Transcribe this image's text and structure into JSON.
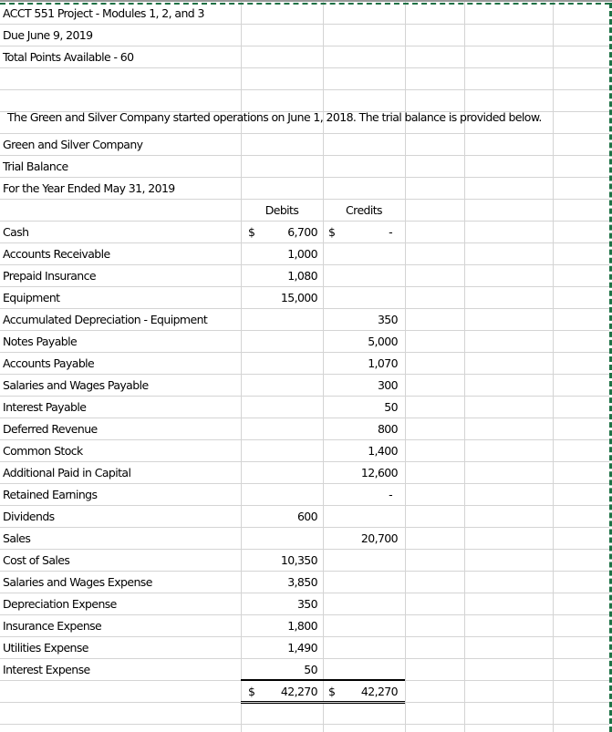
{
  "header": {
    "title": "ACCT 551 Project - Modules 1, 2, and 3",
    "due": "Due June 9, 2019",
    "points": "Total Points Available - 60"
  },
  "intro": "The Green and Silver Company started operations on June 1, 2018.  The trial balance is provided below.",
  "report": {
    "company": "Green and Silver Company",
    "statement": "Trial Balance",
    "period": "For the Year Ended May 31, 2019",
    "col_debits": "Debits",
    "col_credits": "Credits",
    "currency_symbol": "$",
    "accounts": [
      {
        "name": "Cash",
        "debit": "6,700",
        "credit": "-",
        "debit_symbol": "$",
        "credit_symbol": "$"
      },
      {
        "name": "Accounts Receivable",
        "debit": "1,000",
        "credit": ""
      },
      {
        "name": "Prepaid Insurance",
        "debit": "1,080",
        "credit": ""
      },
      {
        "name": "Equipment",
        "debit": "15,000",
        "credit": ""
      },
      {
        "name": "Accumulated Depreciation - Equipment",
        "debit": "",
        "credit": "350"
      },
      {
        "name": "Notes Payable",
        "debit": "",
        "credit": "5,000"
      },
      {
        "name": "Accounts Payable",
        "debit": "",
        "credit": "1,070"
      },
      {
        "name": "Salaries and Wages Payable",
        "debit": "",
        "credit": "300"
      },
      {
        "name": "Interest Payable",
        "debit": "",
        "credit": "50"
      },
      {
        "name": "Deferred Revenue",
        "debit": "",
        "credit": "800"
      },
      {
        "name": "Common Stock",
        "debit": "",
        "credit": "1,400"
      },
      {
        "name": "Additional Paid in Capital",
        "debit": "",
        "credit": "12,600"
      },
      {
        "name": "Retained Earnings",
        "debit": "",
        "credit": "-"
      },
      {
        "name": "Dividends",
        "debit": "600",
        "credit": ""
      },
      {
        "name": "Sales",
        "debit": "",
        "credit": "20,700"
      },
      {
        "name": "Cost of Sales",
        "debit": "10,350",
        "credit": ""
      },
      {
        "name": "Salaries and Wages Expense",
        "debit": "3,850",
        "credit": ""
      },
      {
        "name": "Depreciation Expense",
        "debit": "350",
        "credit": ""
      },
      {
        "name": "Insurance Expense",
        "debit": "1,800",
        "credit": ""
      },
      {
        "name": "Utilities Expense",
        "debit": "1,490",
        "credit": ""
      },
      {
        "name": "Interest Expense",
        "debit": "50",
        "credit": ""
      }
    ],
    "totals": {
      "debit": "42,270",
      "credit": "42,270",
      "debit_symbol": "$",
      "credit_symbol": "$"
    }
  }
}
